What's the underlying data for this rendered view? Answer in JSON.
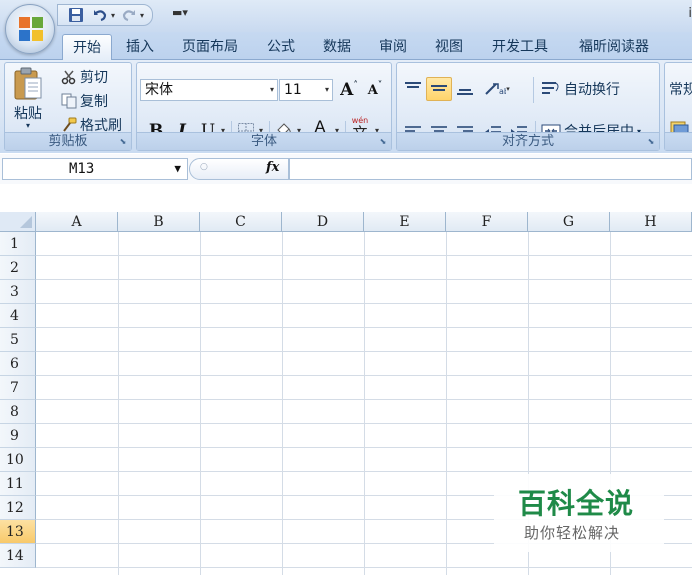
{
  "title_bar": {
    "doc_title_fragment": "i"
  },
  "tabs": [
    "开始",
    "插入",
    "页面布局",
    "公式",
    "数据",
    "审阅",
    "视图",
    "开发工具",
    "福昕阅读器"
  ],
  "clipboard": {
    "paste": "粘贴",
    "cut": "剪切",
    "copy": "复制",
    "format_painter": "格式刷",
    "group_label": "剪贴板"
  },
  "font": {
    "name": "宋体",
    "size": "11",
    "bold": "B",
    "italic": "I",
    "underline": "U",
    "group_label": "字体",
    "grow": "A",
    "shrink": "A",
    "wen": "wén",
    "wen_char": "文"
  },
  "alignment": {
    "wrap_text": "自动换行",
    "merge_center": "合并后居中",
    "group_label": "对齐方式"
  },
  "number": {
    "format_fragment": "常规"
  },
  "formula_bar": {
    "cell_ref": "M13",
    "fx": "fx",
    "formula": ""
  },
  "columns": [
    "A",
    "B",
    "C",
    "D",
    "E",
    "F",
    "G",
    "H"
  ],
  "rows": [
    "1",
    "2",
    "3",
    "4",
    "5",
    "6",
    "7",
    "8",
    "9",
    "10",
    "11",
    "12",
    "13",
    "14"
  ],
  "selected_row": "13",
  "colors": {
    "accent": "#ffd46b",
    "font_color": "#e02020",
    "highlight": "#ffff00",
    "watermark": "#1f8a48"
  },
  "watermark": {
    "title": "百科全说",
    "subtitle": "助你轻松解决"
  }
}
